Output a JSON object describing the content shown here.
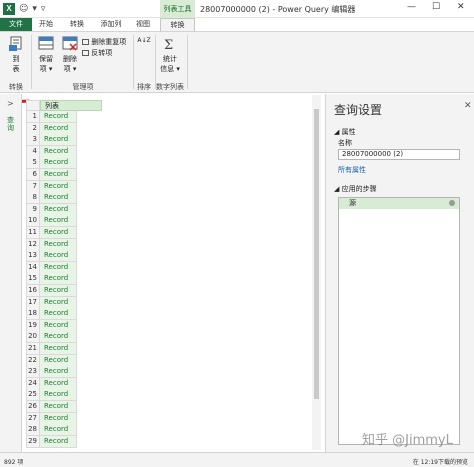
{
  "titlebar": {
    "app_icon": "X",
    "qat_smiley": "☺",
    "qat_dropdown": "▾",
    "qat_more": "▿",
    "context_tab_group": "列表工具",
    "window_title": "28007000000 (2) - Power Query 编辑器",
    "minimize": "—",
    "maximize": "☐",
    "close": "✕"
  },
  "tabs": [
    {
      "label": "文件"
    },
    {
      "label": "开始"
    },
    {
      "label": "转换"
    },
    {
      "label": "添加列"
    },
    {
      "label": "视图"
    },
    {
      "label": "转换"
    }
  ],
  "ribbon": {
    "to_table_label": "到\n表",
    "to_table_line1": "到",
    "to_table_line2": "表",
    "keep_items_line1": "保留",
    "keep_items_line2": "项 ▾",
    "remove_items_line1": "删除",
    "remove_items_line2": "项 ▾",
    "remove_duplicates": "删除重复项",
    "reverse_items": "反转项",
    "sort_asc": "A↓Z",
    "stats_line1": "统计",
    "stats_line2": "信息 ▾",
    "group_convert": "转换",
    "group_manage_items": "管理项",
    "group_sort": "排序",
    "group_numeric_list": "数字列表"
  },
  "leftnav": {
    "expand_arrow": ">",
    "label": "查询"
  },
  "grid": {
    "column_header": "列表",
    "rows": [
      {
        "n": "1",
        "v": "Record"
      },
      {
        "n": "2",
        "v": "Record"
      },
      {
        "n": "3",
        "v": "Record"
      },
      {
        "n": "4",
        "v": "Record"
      },
      {
        "n": "5",
        "v": "Record"
      },
      {
        "n": "6",
        "v": "Record"
      },
      {
        "n": "7",
        "v": "Record"
      },
      {
        "n": "8",
        "v": "Record"
      },
      {
        "n": "9",
        "v": "Record"
      },
      {
        "n": "10",
        "v": "Record"
      },
      {
        "n": "11",
        "v": "Record"
      },
      {
        "n": "12",
        "v": "Record"
      },
      {
        "n": "13",
        "v": "Record"
      },
      {
        "n": "14",
        "v": "Record"
      },
      {
        "n": "15",
        "v": "Record"
      },
      {
        "n": "16",
        "v": "Record"
      },
      {
        "n": "17",
        "v": "Record"
      },
      {
        "n": "18",
        "v": "Record"
      },
      {
        "n": "19",
        "v": "Record"
      },
      {
        "n": "20",
        "v": "Record"
      },
      {
        "n": "21",
        "v": "Record"
      },
      {
        "n": "22",
        "v": "Record"
      },
      {
        "n": "23",
        "v": "Record"
      },
      {
        "n": "24",
        "v": "Record"
      },
      {
        "n": "25",
        "v": "Record"
      },
      {
        "n": "26",
        "v": "Record"
      },
      {
        "n": "27",
        "v": "Record"
      },
      {
        "n": "28",
        "v": "Record"
      },
      {
        "n": "29",
        "v": "Record"
      }
    ]
  },
  "query_settings": {
    "title": "查询设置",
    "close": "✕",
    "properties_header": "◢ 属性",
    "name_label": "名称",
    "name_value": "28007000000 (2)",
    "all_properties_link": "所有属性",
    "applied_steps_header": "◢ 应用的步骤",
    "steps": [
      {
        "label": "源"
      }
    ]
  },
  "statusbar": {
    "left": "892 项",
    "right": "在 12:19下载的预览"
  },
  "watermark": "知乎 @JimmyL"
}
